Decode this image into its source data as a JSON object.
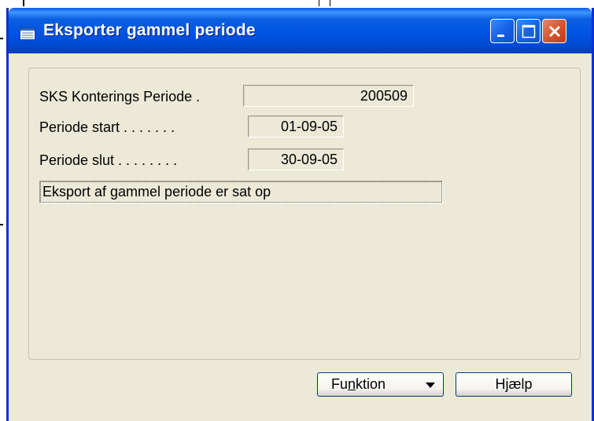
{
  "window": {
    "title": "Eksporter gammel periode",
    "title_icon": "form-icon",
    "controls": [
      "minimize-icon",
      "maximize-icon",
      "close-icon"
    ]
  },
  "fields": [
    {
      "label": "SKS Konterings Periode  .",
      "value": "200509"
    },
    {
      "label": "Periode start . . . . . . .",
      "value": "01-09-05"
    },
    {
      "label": "Periode slut . . . . . . . .",
      "value": "30-09-05"
    }
  ],
  "message": "Eksport af gammel periode er sat op",
  "buttons": {
    "function_pre": "Fu",
    "function_key": "n",
    "function_post": "ktion",
    "help": "Hjælp"
  },
  "colors": {
    "titlebar": "#0054e3",
    "window_bg": "#ece9d8",
    "close_button": "#d4542c"
  }
}
